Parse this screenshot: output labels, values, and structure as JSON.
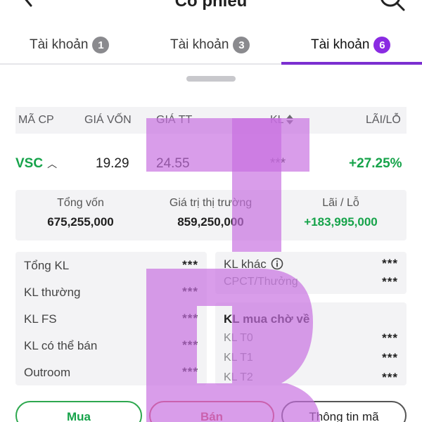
{
  "header": {
    "title": "Cổ phiếu",
    "back_icon": "back-arrow-icon",
    "search_icon": "search-icon"
  },
  "tabs": [
    {
      "label": "Tài khoản",
      "count": "1",
      "active": false
    },
    {
      "label": "Tài khoản",
      "count": "3",
      "active": false
    },
    {
      "label": "Tài khoản",
      "count": "6",
      "active": true
    }
  ],
  "table": {
    "headers": {
      "symbol": "MÃ CP",
      "cost_price": "GIÁ VỐN",
      "market_price": "GIÁ TT",
      "volume": "KL",
      "profit_loss": "LÃI/LỖ"
    },
    "row": {
      "symbol": "VSC",
      "cost_price": "19.29",
      "market_price": "24.55",
      "volume": "***",
      "profit_loss": "+27.25%"
    }
  },
  "summary": {
    "total_capital_label": "Tổng vốn",
    "total_capital": "675,255,000",
    "market_value_label": "Giá trị thị trường",
    "market_value": "859,250,000",
    "pl_label": "Lãi / Lỗ",
    "pl_value": "+183,995,000"
  },
  "left_panel": [
    {
      "label": "Tổng KL",
      "value": "***"
    },
    {
      "label": "KL thường",
      "value": "***"
    },
    {
      "label": "KL FS",
      "value": "***"
    },
    {
      "label": "KL có thể bán",
      "value": "***"
    },
    {
      "label": "Outroom",
      "value": "***"
    }
  ],
  "right_panel_top": {
    "other_label": "KL khác",
    "other_value": "***",
    "bonus_label": "CPCT/Thưởng",
    "bonus_value": "***"
  },
  "right_panel_bottom": {
    "title": "KL mua chờ về",
    "t0_label": "KL T0",
    "t0_value": "***",
    "t1_label": "KL T1",
    "t1_value": "***",
    "t2_label": "KL T2",
    "t2_value": "***"
  },
  "actions": {
    "buy": "Mua",
    "sell": "Bán",
    "info": "Thông tin mã"
  },
  "colors": {
    "accent": "#7b2fd0",
    "positive": "#16a34a",
    "negative": "#d14444",
    "watermark": "#c76ee0"
  }
}
